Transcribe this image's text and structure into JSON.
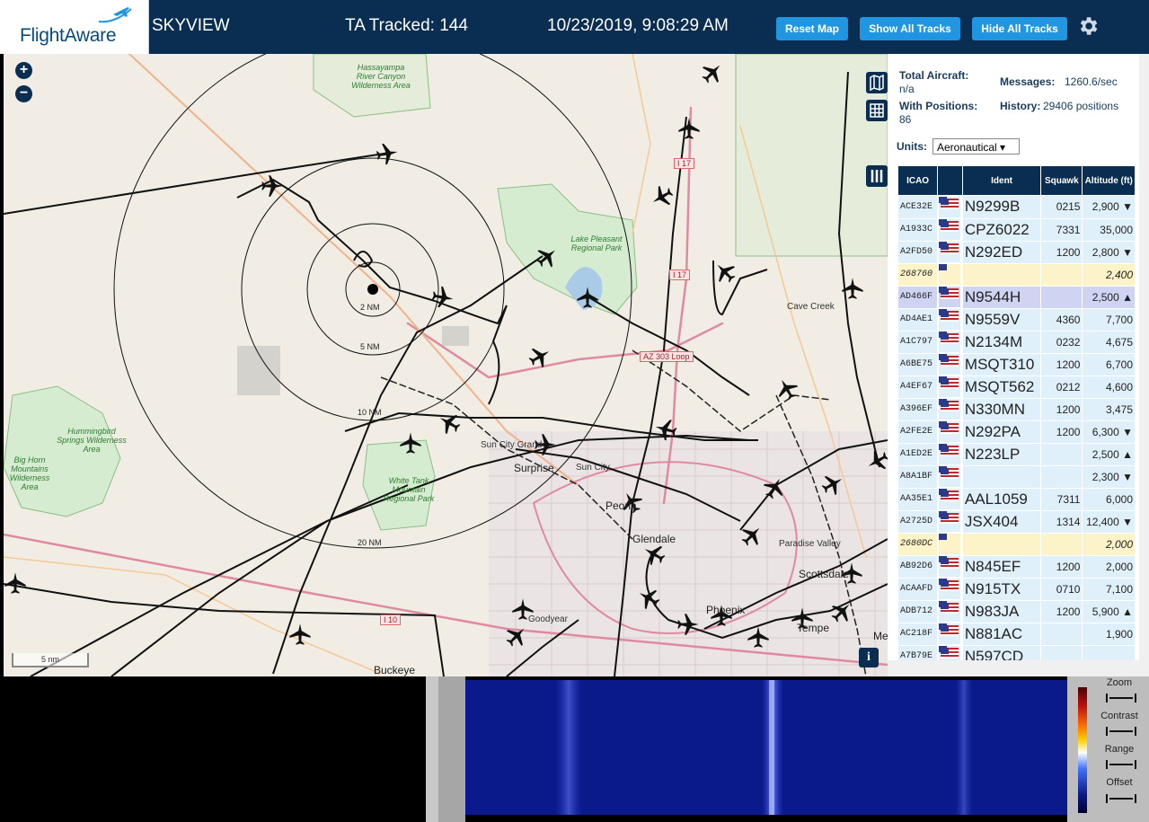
{
  "header": {
    "brand": "FlightAware",
    "title": "SKYVIEW",
    "tracked": "TA Tracked: 144",
    "datetime": "10/23/2019, 9:08:29 AM",
    "buttons": {
      "reset": "Reset Map",
      "show_all": "Show All Tracks",
      "hide_all": "Hide All Tracks"
    },
    "settings_icon": "gear-icon"
  },
  "map": {
    "zoom_in": "+",
    "zoom_out": "−",
    "scale_label": "5 nm",
    "info_label": "i",
    "range_rings": [
      "2 NM",
      "5 NM",
      "10 NM",
      "20 NM"
    ],
    "places": {
      "hassayampa": "Hassayampa River Canyon Wilderness Area",
      "hummingbird": "Hummingbird Springs Wilderness Area",
      "bighorn": "Big Horn Mountains Wilderness Area",
      "white_tank": "White Tank Mountain Regional Park",
      "lake_pleasant": "Lake Pleasant Regional Park",
      "cave_creek": "Cave Creek",
      "sun_city_grand": "Sun City Grand",
      "surprise": "Surprise",
      "sun_city": "Sun City",
      "peoria": "Peoria",
      "glendale": "Glendale",
      "paradise_valley": "Paradise Valley",
      "scottsdale": "Scottsdale",
      "phoenix": "Phoenix",
      "tempe": "Tempe",
      "goodyear": "Goodyear",
      "buckeye": "Buckeye",
      "mesa": "Me"
    },
    "highways": {
      "i17a": "I 17",
      "i17b": "I 17",
      "az303": "AZ 303 Loop",
      "i10": "I 10"
    }
  },
  "stats": {
    "total_label": "Total Aircraft:",
    "total_value": "n/a",
    "messages_label": "Messages:",
    "messages_value": "1260.6/sec",
    "positions_label": "With Positions:",
    "positions_value": "86",
    "history_label": "History:",
    "history_value": "29406 positions",
    "units_label": "Units:",
    "units_value": "Aeronautical ▾"
  },
  "table": {
    "headers": {
      "icao": "ICAO",
      "ident": "Ident",
      "squawk": "Squawk",
      "altitude": "Altitude (ft)"
    },
    "rows": [
      {
        "icao": "ACE32E",
        "ident": "N9299B",
        "squawk": "0215",
        "alt": "2,900 ▼",
        "type": "normal"
      },
      {
        "icao": "A1933C",
        "ident": "CPZ6022",
        "squawk": "7331",
        "alt": "35,000",
        "type": "normal"
      },
      {
        "icao": "A2FD50",
        "ident": "N292ED",
        "squawk": "1200",
        "alt": "2,800 ▼",
        "type": "normal"
      },
      {
        "icao": "268760",
        "ident": "",
        "squawk": "",
        "alt": "2,400",
        "type": "nopos"
      },
      {
        "icao": "AD466F",
        "ident": "N9544H",
        "squawk": "",
        "alt": "2,500 ▲",
        "type": "sel"
      },
      {
        "icao": "AD4AE1",
        "ident": "N9559V",
        "squawk": "4360",
        "alt": "7,700",
        "type": "normal"
      },
      {
        "icao": "A1C797",
        "ident": "N2134M",
        "squawk": "0232",
        "alt": "4,675",
        "type": "normal"
      },
      {
        "icao": "A6BE75",
        "ident": "MSQT310",
        "squawk": "1200",
        "alt": "6,700",
        "type": "normal"
      },
      {
        "icao": "A4EF67",
        "ident": "MSQT562",
        "squawk": "0212",
        "alt": "4,600",
        "type": "normal"
      },
      {
        "icao": "A396EF",
        "ident": "N330MN",
        "squawk": "1200",
        "alt": "3,475",
        "type": "normal"
      },
      {
        "icao": "A2FE2E",
        "ident": "N292PA",
        "squawk": "1200",
        "alt": "6,300 ▼",
        "type": "normal"
      },
      {
        "icao": "A1ED2E",
        "ident": "N223LP",
        "squawk": "",
        "alt": "2,500 ▲",
        "type": "normal"
      },
      {
        "icao": "A8A1BF",
        "ident": "",
        "squawk": "",
        "alt": "2,300 ▼",
        "type": "normal"
      },
      {
        "icao": "AA35E1",
        "ident": "AAL1059",
        "squawk": "7311",
        "alt": "6,000",
        "type": "normal"
      },
      {
        "icao": "A2725D",
        "ident": "JSX404",
        "squawk": "1314",
        "alt": "12,400 ▼",
        "type": "normal"
      },
      {
        "icao": "2680DC",
        "ident": "",
        "squawk": "",
        "alt": "2,000",
        "type": "nopos"
      },
      {
        "icao": "AB92D6",
        "ident": "N845EF",
        "squawk": "1200",
        "alt": "2,000",
        "type": "normal"
      },
      {
        "icao": "ACAAFD",
        "ident": "N915TX",
        "squawk": "0710",
        "alt": "7,100",
        "type": "normal"
      },
      {
        "icao": "ADB712",
        "ident": "N983JA",
        "squawk": "1200",
        "alt": "5,900 ▲",
        "type": "normal"
      },
      {
        "icao": "AC218F",
        "ident": "N881AC",
        "squawk": "",
        "alt": "1,900",
        "type": "normal"
      },
      {
        "icao": "A7B79E",
        "ident": "N597CD",
        "squawk": "",
        "alt": "",
        "type": "normal"
      }
    ]
  },
  "spectrum": {
    "controls": {
      "zoom": "Zoom",
      "contrast": "Contrast",
      "range": "Range",
      "offset": "Offset"
    }
  }
}
